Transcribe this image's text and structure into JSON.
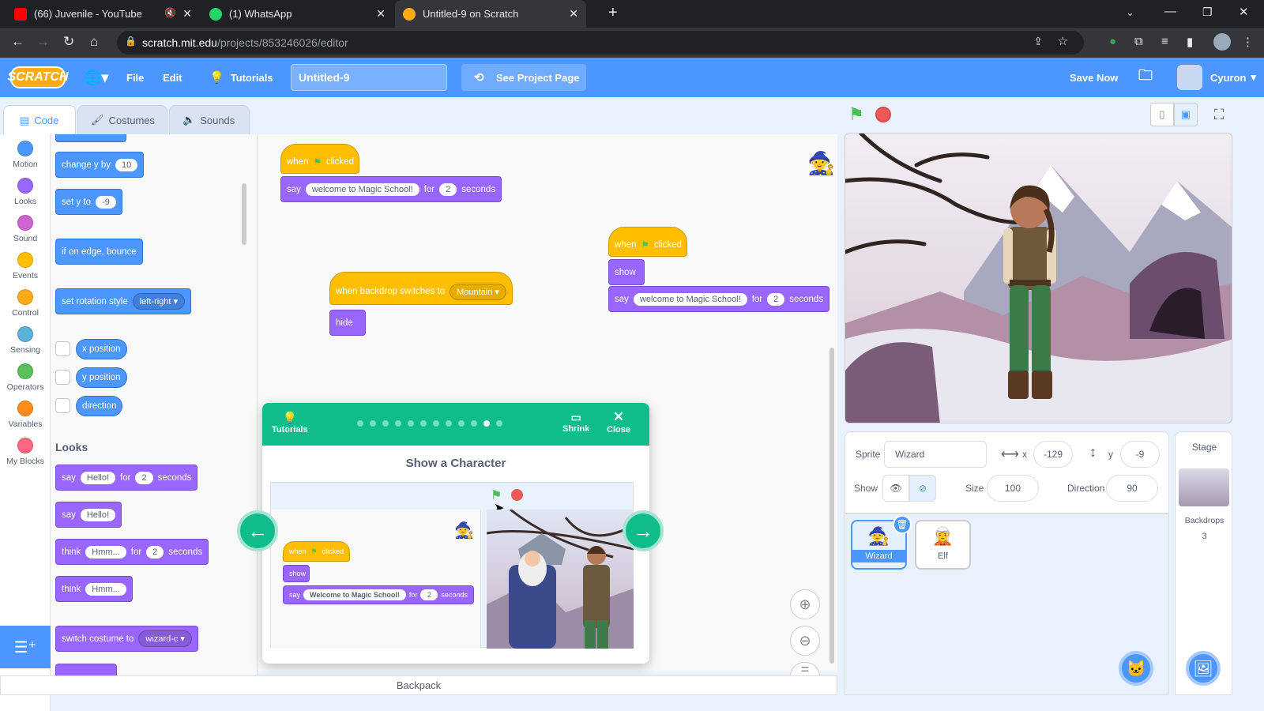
{
  "browser": {
    "tabs": [
      {
        "title": "(66) Juvenile - YouTube",
        "icon": "youtube-icon"
      },
      {
        "title": "(1) WhatsApp",
        "icon": "whatsapp-icon"
      },
      {
        "title": "Untitled-9 on Scratch",
        "icon": "scratch-icon"
      }
    ],
    "url_host": "scratch.mit.edu",
    "url_path": "/projects/853246026/editor"
  },
  "menubar": {
    "logo": "SCRATCH",
    "file": "File",
    "edit": "Edit",
    "tutorials": "Tutorials",
    "project_title": "Untitled-9",
    "see_project": "See Project Page",
    "save_now": "Save Now",
    "username": "Cyuron"
  },
  "editor_tabs": {
    "code": "Code",
    "costumes": "Costumes",
    "sounds": "Sounds"
  },
  "categories": [
    {
      "label": "Motion",
      "color": "#4c97ff"
    },
    {
      "label": "Looks",
      "color": "#9966ff"
    },
    {
      "label": "Sound",
      "color": "#cf63cf"
    },
    {
      "label": "Events",
      "color": "#ffbf00"
    },
    {
      "label": "Control",
      "color": "#ffab19"
    },
    {
      "label": "Sensing",
      "color": "#5cb1d6"
    },
    {
      "label": "Operators",
      "color": "#59c059"
    },
    {
      "label": "Variables",
      "color": "#ff8c1a"
    },
    {
      "label": "My Blocks",
      "color": "#ff6680"
    }
  ],
  "palette": {
    "change_y": {
      "text": "change y by",
      "value": "10"
    },
    "set_y": {
      "text": "set y to",
      "value": "-9"
    },
    "bounce": "if on edge, bounce",
    "rotation": {
      "text": "set rotation style",
      "value": "left-right"
    },
    "x_position": "x position",
    "y_position": "y position",
    "direction": "direction",
    "looks_heading": "Looks",
    "say_for": {
      "say": "say",
      "msg": "Hello!",
      "for": "for",
      "secs": "2",
      "seconds": "seconds"
    },
    "say": {
      "say": "say",
      "msg": "Hello!"
    },
    "think_for": {
      "think": "think",
      "msg": "Hmm...",
      "for": "for",
      "secs": "2",
      "seconds": "seconds"
    },
    "think": {
      "think": "think",
      "msg": "Hmm..."
    },
    "switch_costume": {
      "text": "switch costume to",
      "value": "wizard-c"
    }
  },
  "scripts": {
    "s1": {
      "when": "when",
      "clicked": "clicked",
      "say": "say",
      "msg": "welcome to Magic School!",
      "for": "for",
      "secs": "2",
      "seconds": "seconds"
    },
    "s2": {
      "text": "when backdrop switches to",
      "value": "Mountain",
      "hide": "hide"
    },
    "s3": {
      "when": "when",
      "clicked": "clicked",
      "show": "show",
      "say": "say",
      "msg": "welcome to Magic School!",
      "for": "for",
      "secs": "2",
      "seconds": "seconds"
    }
  },
  "tutorial": {
    "tutorials_label": "Tutorials",
    "shrink": "Shrink",
    "close": "Close",
    "title": "Show a Character",
    "steps_total": 12,
    "current_step": 11,
    "mini": {
      "when": "when",
      "clicked": "clicked",
      "show": "show",
      "say": "say",
      "msg": "Welcome to Magic School!",
      "for": "for",
      "secs": "2",
      "seconds": "seconds"
    }
  },
  "sprite_info": {
    "sprite_label": "Sprite",
    "sprite_name": "Wizard",
    "x_label": "x",
    "x": "-129",
    "y_label": "y",
    "y": "-9",
    "show_label": "Show",
    "size_label": "Size",
    "size": "100",
    "direction_label": "Direction",
    "direction": "90"
  },
  "sprites": [
    {
      "name": "Wizard",
      "selected": true
    },
    {
      "name": "Elf",
      "selected": false
    }
  ],
  "stage_panel": {
    "title": "Stage",
    "backdrops_label": "Backdrops",
    "backdrops_count": "3"
  },
  "backpack": "Backpack"
}
